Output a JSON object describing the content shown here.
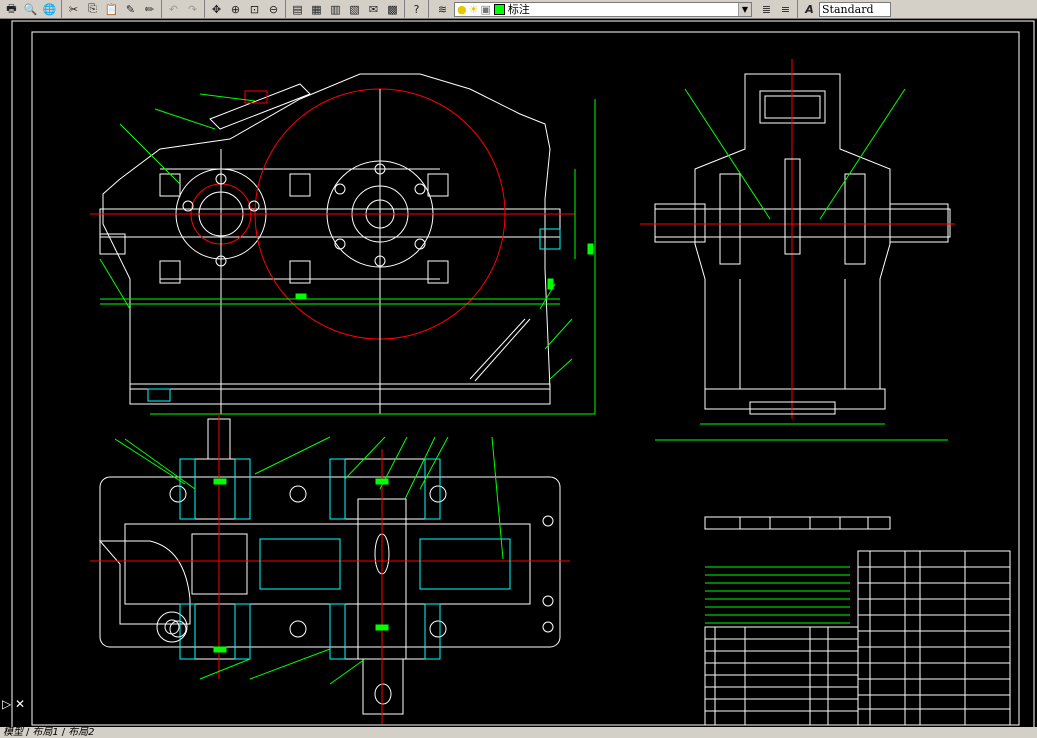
{
  "toolbar": {
    "buttons": [
      {
        "name": "print-icon",
        "glyph": "🖶"
      },
      {
        "name": "plot-preview-icon",
        "glyph": "🔍"
      },
      {
        "name": "publish-icon",
        "glyph": "🌐"
      },
      {
        "name": "cut-icon",
        "glyph": "✂"
      },
      {
        "name": "copy-icon",
        "glyph": "⎘"
      },
      {
        "name": "paste-icon",
        "glyph": "📋"
      },
      {
        "name": "match-properties-icon",
        "glyph": "✎"
      },
      {
        "name": "block-editor-icon",
        "glyph": "✏"
      },
      {
        "name": "undo-icon",
        "glyph": "↶"
      },
      {
        "name": "redo-icon",
        "glyph": "↷"
      },
      {
        "name": "pan-icon",
        "glyph": "✥"
      },
      {
        "name": "zoom-realtime-icon",
        "glyph": "⊕"
      },
      {
        "name": "zoom-window-icon",
        "glyph": "⊡"
      },
      {
        "name": "zoom-previous-icon",
        "glyph": "⊖"
      },
      {
        "name": "properties-icon",
        "glyph": "▤"
      },
      {
        "name": "design-center-icon",
        "glyph": "▦"
      },
      {
        "name": "tool-palettes-icon",
        "glyph": "▥"
      },
      {
        "name": "sheet-set-icon",
        "glyph": "▧"
      },
      {
        "name": "markup-icon",
        "glyph": "✉"
      },
      {
        "name": "calculator-icon",
        "glyph": "▩"
      },
      {
        "name": "help-icon",
        "glyph": "?"
      }
    ],
    "layer_value": "标注",
    "layer_color": "#00ff00",
    "text_style": "Standard"
  },
  "status": {
    "tabs": [
      "模型",
      "布局1",
      "布局2"
    ]
  },
  "drawing": {
    "line_color": "#ffffff",
    "center_color": "#ff0000",
    "dim_color": "#00ff00",
    "hatch_color": "#00ffff",
    "frame_color": "#ffffff",
    "background": "#000000"
  }
}
